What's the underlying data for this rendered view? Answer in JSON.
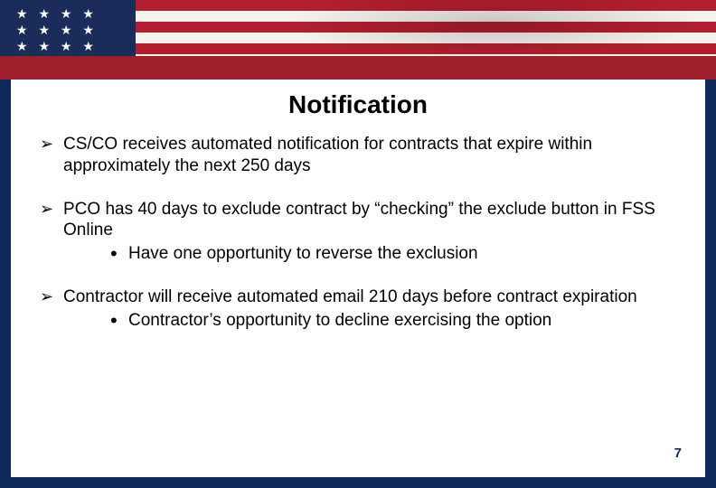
{
  "title": "Notification",
  "bullets": [
    {
      "text": "CS/CO receives automated notification for contracts that expire within approximately the next 250 days",
      "sub": []
    },
    {
      "text": "PCO has 40 days to exclude contract by “checking” the exclude button in FSS Online",
      "sub": [
        "Have one opportunity to reverse the exclusion"
      ]
    },
    {
      "text": "Contractor will receive automated email 210 days before contract expiration",
      "sub": [
        "Contractor’s opportunity to decline exercising the option"
      ]
    }
  ],
  "page_number": "7"
}
